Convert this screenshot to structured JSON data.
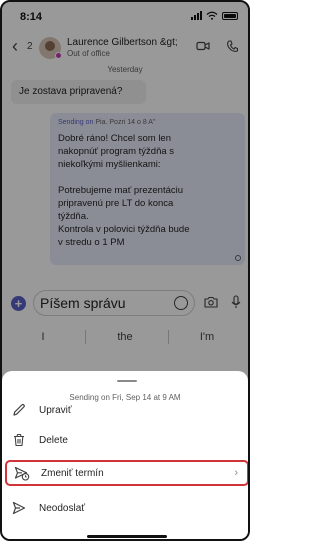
{
  "status_bar": {
    "time": "8:14"
  },
  "chat_header": {
    "back_count": "2",
    "contact_name": "Laurence Gilbertson &gt;",
    "contact_status": "Out of office"
  },
  "conversation": {
    "day_label": "Yesterday",
    "incoming_message": "Je zostava pripravená?",
    "scheduled_message": {
      "sending_label": "Sending on",
      "sending_meta": "Pia. Pozri 14 o 8 A\"",
      "body": [
        "Dobré ráno! Chcel som len",
        "nakopnúť program týždňa s",
        "niekoľkými myšlienkami:",
        "",
        "Potrebujeme mať prezentáciu",
        "pripravenú pre LT do konca",
        "týždňa.",
        "Kontrola v polovici týždňa bude",
        "v stredu o 1 PM"
      ]
    }
  },
  "composer": {
    "placeholder": "Píšem správu"
  },
  "keyboard_suggestions": [
    "I",
    "the",
    "I'm"
  ],
  "sheet": {
    "title": "Sending on Fri, Sep 14 at 9 AM",
    "items": [
      {
        "label": "Upraviť",
        "icon": "pencil-icon"
      },
      {
        "label": "Delete",
        "icon": "trash-icon"
      },
      {
        "label": "Zmeniť termín",
        "icon": "reschedule-send-icon",
        "highlighted": true
      },
      {
        "label": "Neodoslať",
        "icon": "send-icon"
      }
    ]
  },
  "colors": {
    "accent": "#5b5fc7",
    "highlight_border": "#d13438",
    "scheduled_bubble": "#e8ebfa",
    "presence": "#c239b3"
  }
}
